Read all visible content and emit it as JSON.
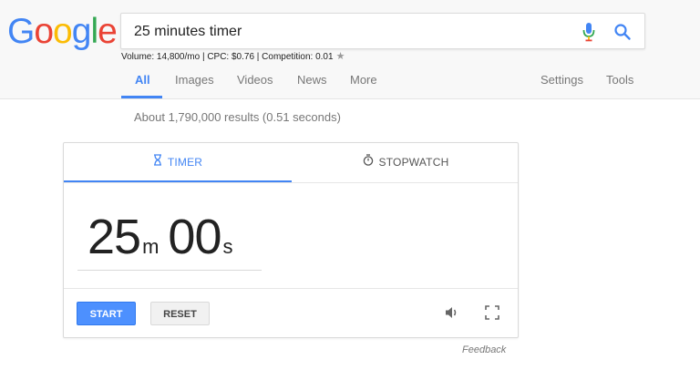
{
  "logo": {
    "letters": [
      "G",
      "o",
      "o",
      "g",
      "l",
      "e"
    ],
    "colors": [
      "#4285f4",
      "#ea4335",
      "#fbbc05",
      "#4285f4",
      "#34a853",
      "#ea4335"
    ]
  },
  "search": {
    "value": "25 minutes timer"
  },
  "seo_bar": {
    "text": "Volume: 14,800/mo | CPC: $0.76 | Competition: 0.01"
  },
  "tabs": [
    {
      "label": "All",
      "active": true
    },
    {
      "label": "Images"
    },
    {
      "label": "Videos"
    },
    {
      "label": "News"
    },
    {
      "label": "More"
    },
    {
      "label": "Settings"
    },
    {
      "label": "Tools"
    }
  ],
  "results": {
    "count_text": "About 1,790,000 results (0.51 seconds)"
  },
  "timer_card": {
    "tab_timer": "TIMER",
    "tab_stopwatch": "STOPWATCH",
    "minutes": "25",
    "minutes_unit": "m",
    "seconds": "00",
    "seconds_unit": "s",
    "start_label": "START",
    "reset_label": "RESET"
  },
  "feedback": "Feedback",
  "colors": {
    "accent": "#4285f4",
    "start_button": "#4d90fe"
  }
}
